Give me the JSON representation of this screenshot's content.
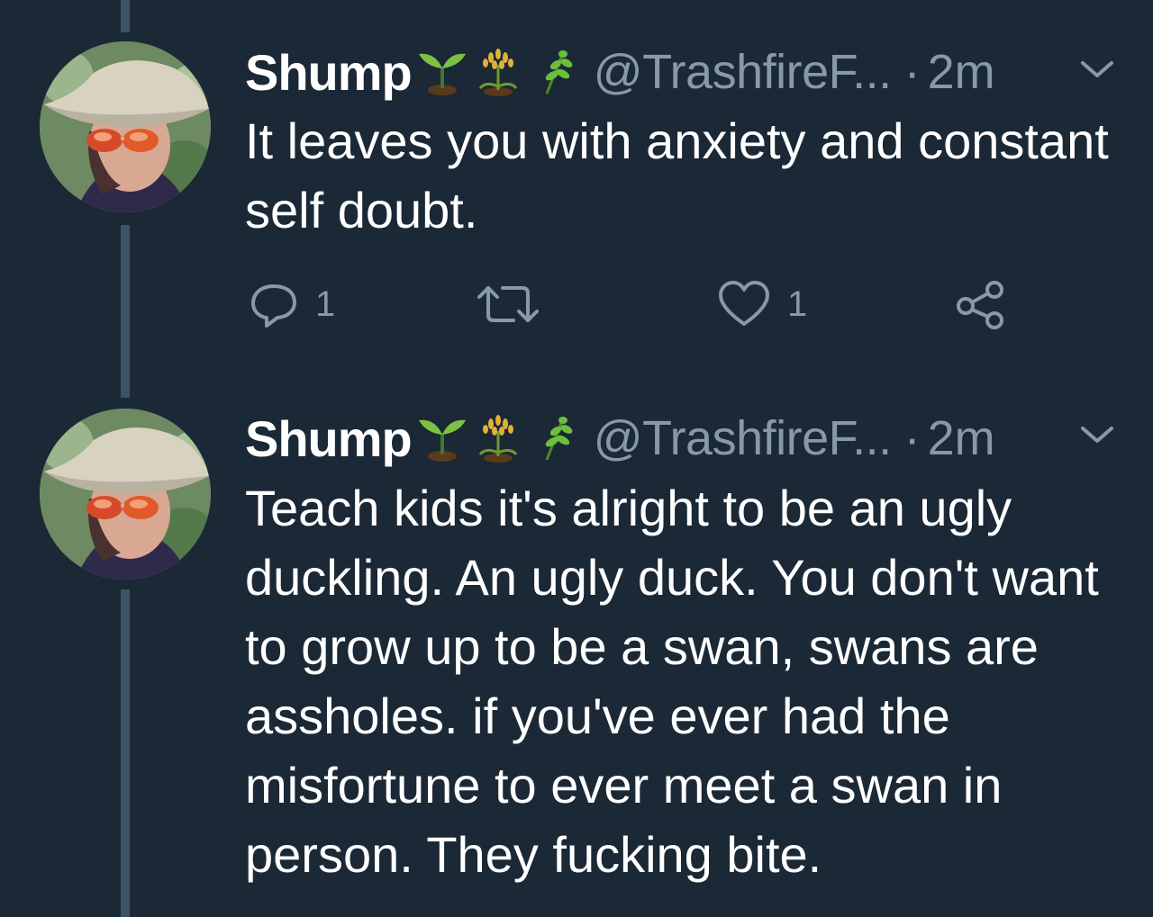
{
  "tweets": [
    {
      "display_name": "Shump",
      "emojis": [
        "seedling-emoji",
        "rice-plant-emoji",
        "herb-emoji"
      ],
      "handle": "@TrashfireF...",
      "separator": "·",
      "time": "2m",
      "text": "It leaves you with anxiety and constant self doubt.",
      "actions": {
        "reply_count": "1",
        "retweet_count": "",
        "like_count": "1"
      }
    },
    {
      "display_name": "Shump",
      "emojis": [
        "seedling-emoji",
        "rice-plant-emoji",
        "herb-emoji"
      ],
      "handle": "@TrashfireF...",
      "separator": "·",
      "time": "2m",
      "text": "Teach kids it's alright to be an ugly duckling. An ugly duck. You don't want to grow up to be a swan, swans are assholes. if you've ever had the misfortune to ever meet a swan in person. They fucking bite."
    }
  ],
  "colors": {
    "background": "#1b2836",
    "thread_line": "#3d5466",
    "secondary_text": "#8899a6",
    "primary_text": "#ffffff"
  }
}
